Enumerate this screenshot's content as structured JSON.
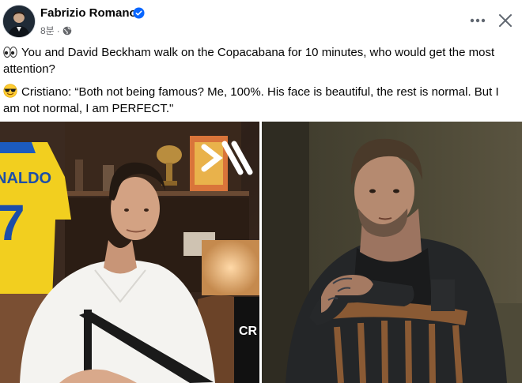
{
  "post": {
    "author": "Fabrizio Romano",
    "timestamp": "8분",
    "separator": "·",
    "line1_text": "You and David Beckham walk on the Copacabana for 10 minutes, who would get the most attention?",
    "line2_text": "Cristiano: “Both not being famous? Me, 100%. His face is beautiful, the rest is normal. But I am not normal, I am PERFECT.\""
  },
  "media": {
    "jersey_text": "NALDO",
    "jersey_number": "7",
    "watermark": "CR"
  },
  "icons": {
    "verified": "verified-badge-icon",
    "privacy": "globe-icon",
    "more": "more-horizontal-icon",
    "close": "close-icon",
    "emoji1": "eyes-emoji",
    "emoji2": "sunglasses-emoji"
  },
  "colors": {
    "verified_blue": "#0866ff",
    "meta_gray": "#65676b",
    "text": "#050505"
  }
}
